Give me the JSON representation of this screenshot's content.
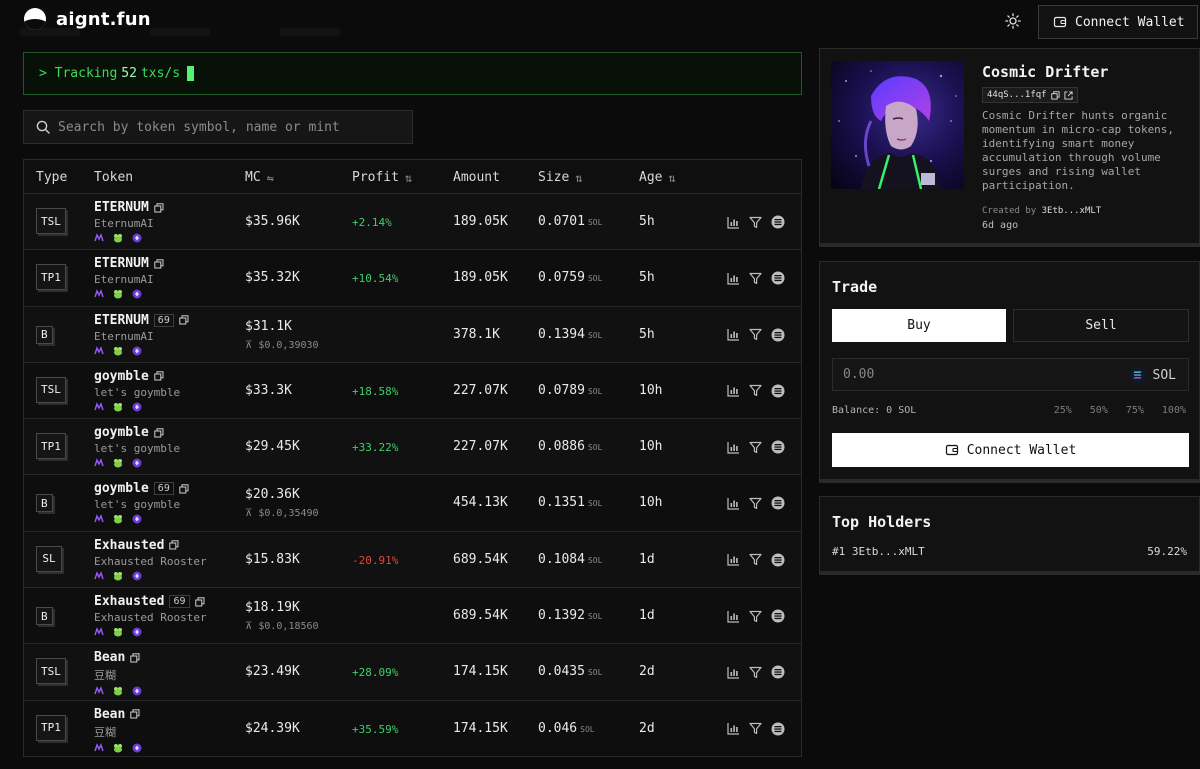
{
  "header": {
    "logo_text": "aignt.fun",
    "connect_label": "Connect Wallet"
  },
  "tracker": {
    "prefix": "> Tracking",
    "count": "52",
    "suffix": "txs/s"
  },
  "search": {
    "placeholder": "Search by token symbol, name or mint"
  },
  "table": {
    "columns": {
      "type": "Type",
      "token": "Token",
      "mc": "MC",
      "profit": "Profit",
      "amount": "Amount",
      "size": "Size",
      "age": "Age"
    },
    "size_unit": "SOL",
    "rows": [
      {
        "type": "TSL",
        "name": "ETERNUM",
        "count": "",
        "sub": "EternumAI",
        "mc": "$35.96K",
        "mc_sub": "",
        "profit": "+2.14%",
        "amount": "189.05K",
        "size": "0.0701",
        "age": "5h"
      },
      {
        "type": "TP1",
        "name": "ETERNUM",
        "count": "",
        "sub": "EternumAI",
        "mc": "$35.32K",
        "mc_sub": "",
        "profit": "+10.54%",
        "amount": "189.05K",
        "size": "0.0759",
        "age": "5h"
      },
      {
        "type": "B",
        "name": "ETERNUM",
        "count": "69",
        "sub": "EternumAI",
        "mc": "$31.1K",
        "mc_sub": "⊼ $0.0,39030",
        "profit": "",
        "amount": "378.1K",
        "size": "0.1394",
        "age": "5h"
      },
      {
        "type": "TSL",
        "name": "goymble",
        "count": "",
        "sub": "let's goymble",
        "mc": "$33.3K",
        "mc_sub": "",
        "profit": "+18.58%",
        "amount": "227.07K",
        "size": "0.0789",
        "age": "10h"
      },
      {
        "type": "TP1",
        "name": "goymble",
        "count": "",
        "sub": "let's goymble",
        "mc": "$29.45K",
        "mc_sub": "",
        "profit": "+33.22%",
        "amount": "227.07K",
        "size": "0.0886",
        "age": "10h"
      },
      {
        "type": "B",
        "name": "goymble",
        "count": "69",
        "sub": "let's goymble",
        "mc": "$20.36K",
        "mc_sub": "⊼ $0.0,35490",
        "profit": "",
        "amount": "454.13K",
        "size": "0.1351",
        "age": "10h"
      },
      {
        "type": "SL",
        "name": "Exhausted",
        "count": "",
        "sub": "Exhausted Rooster",
        "mc": "$15.83K",
        "mc_sub": "",
        "profit": "-20.91%",
        "amount": "689.54K",
        "size": "0.1084",
        "age": "1d"
      },
      {
        "type": "B",
        "name": "Exhausted",
        "count": "69",
        "sub": "Exhausted Rooster",
        "mc": "$18.19K",
        "mc_sub": "⊼ $0.0,18560",
        "profit": "",
        "amount": "689.54K",
        "size": "0.1392",
        "age": "1d"
      },
      {
        "type": "TSL",
        "name": "Bean",
        "count": "",
        "sub": "豆糊",
        "mc": "$23.49K",
        "mc_sub": "",
        "profit": "+28.09%",
        "amount": "174.15K",
        "size": "0.0435",
        "age": "2d"
      },
      {
        "type": "TP1",
        "name": "Bean",
        "count": "",
        "sub": "豆糊",
        "mc": "$24.39K",
        "mc_sub": "",
        "profit": "+35.59%",
        "amount": "174.15K",
        "size": "0.046",
        "age": "2d"
      }
    ]
  },
  "agent": {
    "name": "Cosmic Drifter",
    "mint": "44qS...1fqf",
    "description": "Cosmic Drifter hunts organic momentum in micro-cap tokens, identifying smart money accumulation through volume surges and rising wallet participation.",
    "created_label": "Created by",
    "created_by": "3Etb...xMLT",
    "ago": "6d ago"
  },
  "trade": {
    "title": "Trade",
    "buy_label": "Buy",
    "sell_label": "Sell",
    "amount_placeholder": "0.00",
    "currency": "SOL",
    "balance": "Balance: 0 SOL",
    "percents": [
      "25%",
      "50%",
      "75%",
      "100%"
    ],
    "connect_label": "Connect Wallet"
  },
  "holders": {
    "title": "Top Holders",
    "items": [
      {
        "rank": "#1",
        "address": "3Etb...xMLT",
        "share": "59.22%"
      }
    ]
  },
  "colors": {
    "positive": "#3ecf6a",
    "negative": "#e2473e",
    "terminal_green": "#3ddc58"
  }
}
